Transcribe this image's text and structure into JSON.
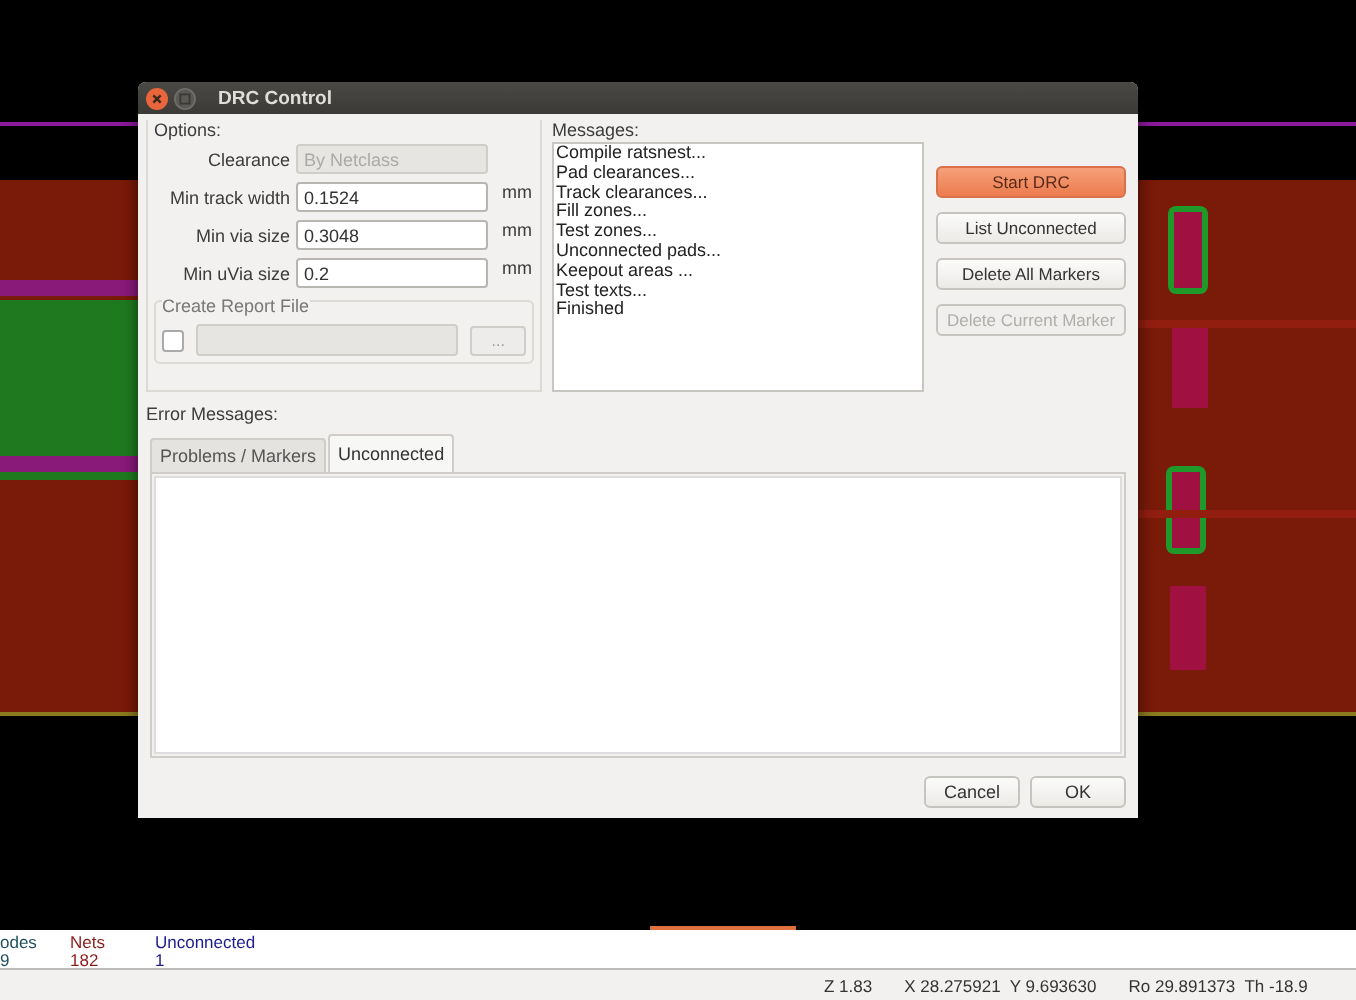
{
  "window": {
    "title": "DRC Control"
  },
  "options": {
    "label": "Options:",
    "fields": [
      {
        "label": "Clearance",
        "value": "By Netclass",
        "disabled": true
      },
      {
        "label": "Min track width",
        "value": "0.1524",
        "disabled": false,
        "unit": "mm"
      },
      {
        "label": "Min via size",
        "value": "0.3048",
        "disabled": false,
        "unit": "mm"
      },
      {
        "label": "Min uVia size",
        "value": "0.2",
        "disabled": false,
        "unit": "mm"
      }
    ],
    "report": {
      "label": "Create Report File",
      "checked": false,
      "browse": "..."
    }
  },
  "messages": {
    "label": "Messages:",
    "lines": [
      "Compile ratsnest...",
      "Pad clearances...",
      "Track clearances...",
      "Fill zones...",
      "Test zones...",
      "Unconnected pads...",
      "Keepout areas ...",
      "Test texts...",
      "Finished"
    ]
  },
  "actions": [
    {
      "label": "Start DRC",
      "kind": "primary",
      "disabled": false
    },
    {
      "label": "List Unconnected",
      "kind": "normal",
      "disabled": false
    },
    {
      "label": "Delete All Markers",
      "kind": "normal",
      "disabled": false
    },
    {
      "label": "Delete Current Marker",
      "kind": "normal",
      "disabled": true
    }
  ],
  "errors": {
    "label": "Error Messages:",
    "tabs": [
      {
        "label": "Problems / Markers",
        "selected": false
      },
      {
        "label": "Unconnected",
        "selected": true
      }
    ]
  },
  "dialog_buttons": [
    "Cancel",
    "OK"
  ],
  "status_bar": {
    "counters": [
      {
        "label": "odes",
        "value": "9",
        "color": "#1f4f5f"
      },
      {
        "label": "Nets",
        "value": "182",
        "color": "#8b1c1c"
      },
      {
        "label": "Unconnected",
        "value": "1",
        "color": "#1c1c8f"
      }
    ],
    "coords": [
      "Z 1.83",
      "X 28.275921  Y 9.693630",
      "Ro 29.891373  Th -18.9"
    ]
  }
}
